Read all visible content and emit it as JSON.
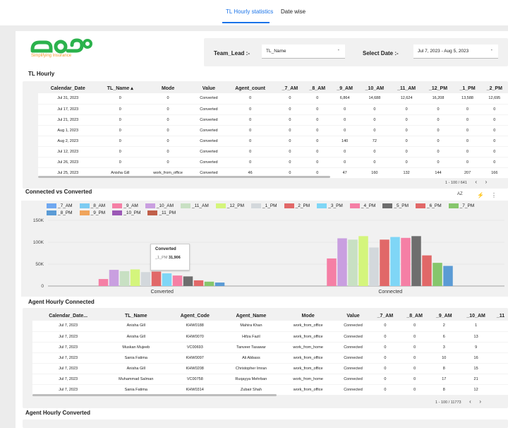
{
  "tabs": [
    {
      "label": "TL Hourly statistics"
    },
    {
      "label": "Date wise"
    }
  ],
  "brand": {
    "logo_text": "Simplifying Insurance",
    "green": "#2bb24c",
    "orange": "#f29a2e"
  },
  "filters": {
    "team_lead_label": "Team_Lead :-",
    "team_lead_value": "TL_Name",
    "date_label": "Select Date :-",
    "date_value": "Jul 7, 2023 - Aug 5, 2023"
  },
  "tl_hourly": {
    "title": "TL Hourly",
    "columns": [
      "Calendar_Date",
      "TL_Name ▴",
      "Mode",
      "Value",
      "Agent_count",
      "_7_AM",
      "_8_AM",
      "_9_AM",
      "_10_AM",
      "_11_AM",
      "_12_PM",
      "_1_PM",
      "_2_PM"
    ],
    "rows": [
      [
        "Jul 31, 2023",
        "0",
        "0",
        "Converted",
        "0",
        "0",
        "0",
        "6,864",
        "14,688",
        "12,624",
        "16,208",
        "13,588",
        "12,695"
      ],
      [
        "Jul 17, 2023",
        "0",
        "0",
        "Converted",
        "0",
        "0",
        "0",
        "0",
        "0",
        "0",
        "0",
        "0",
        "0"
      ],
      [
        "Jul 21, 2023",
        "0",
        "0",
        "Converted",
        "0",
        "0",
        "0",
        "0",
        "0",
        "0",
        "0",
        "0",
        "0"
      ],
      [
        "Aug 1, 2023",
        "0",
        "0",
        "Converted",
        "0",
        "0",
        "0",
        "0",
        "0",
        "0",
        "0",
        "0",
        "0"
      ],
      [
        "Aug 2, 2023",
        "0",
        "0",
        "Converted",
        "0",
        "0",
        "0",
        "140",
        "72",
        "0",
        "0",
        "0",
        "0"
      ],
      [
        "Jul 12, 2023",
        "0",
        "0",
        "Converted",
        "0",
        "0",
        "0",
        "0",
        "0",
        "0",
        "0",
        "0",
        "0"
      ],
      [
        "Jul 26, 2023",
        "0",
        "0",
        "Converted",
        "0",
        "0",
        "0",
        "0",
        "0",
        "0",
        "0",
        "0",
        "0"
      ],
      [
        "Jul 25, 2023",
        "Anisha Gill",
        "work_from_office",
        "Converted",
        "46",
        "0",
        "0",
        "47",
        "160",
        "132",
        "144",
        "207",
        "166"
      ]
    ],
    "pager": "1 - 100 / 641"
  },
  "connected_vs_converted": {
    "title": "Connected vs Converted",
    "tooltip": {
      "title": "Converted",
      "series": "_1_PM",
      "value": "31,906"
    }
  },
  "chart_data": {
    "type": "bar",
    "categories": [
      "Converted",
      "Connected"
    ],
    "yticks": [
      "150K",
      "100K",
      "50K",
      "0"
    ],
    "ylim": [
      0,
      150000
    ],
    "legend_position": "top",
    "series": [
      {
        "name": "_7_AM",
        "color": "#6fa8f0",
        "values": [
          0,
          0
        ]
      },
      {
        "name": "_8_AM",
        "color": "#7ccbf2",
        "values": [
          0,
          0
        ]
      },
      {
        "name": "_9_AM",
        "color": "#f57fa5",
        "values": [
          16000,
          63000
        ]
      },
      {
        "name": "_10_AM",
        "color": "#c99fe0",
        "values": [
          37000,
          109000
        ]
      },
      {
        "name": "_11_AM",
        "color": "#c8e0c3",
        "values": [
          34000,
          106000
        ]
      },
      {
        "name": "_12_PM",
        "color": "#d4f57c",
        "values": [
          38000,
          114000
        ]
      },
      {
        "name": "_1_PM",
        "color": "#d3d8dc",
        "values": [
          31906,
          88000
        ]
      },
      {
        "name": "_2_PM",
        "color": "#e16868",
        "values": [
          33000,
          106000
        ]
      },
      {
        "name": "_3_PM",
        "color": "#7fd6f6",
        "values": [
          29000,
          112000
        ]
      },
      {
        "name": "_4_PM",
        "color": "#f57fa5",
        "values": [
          24000,
          110000
        ]
      },
      {
        "name": "_5_PM",
        "color": "#6e6e6e",
        "values": [
          22000,
          114000
        ]
      },
      {
        "name": "_6_PM",
        "color": "#e16868",
        "values": [
          13000,
          70000
        ]
      },
      {
        "name": "_7_PM",
        "color": "#86c66c",
        "values": [
          10000,
          53000
        ]
      },
      {
        "name": "_8_PM",
        "color": "#5b9bd5",
        "values": [
          8000,
          46000
        ]
      },
      {
        "name": "_9_PM",
        "color": "#f0a45b",
        "values": [
          0,
          0
        ]
      },
      {
        "name": "_10_PM",
        "color": "#9b59b6",
        "values": [
          0,
          0
        ]
      },
      {
        "name": "_11_PM",
        "color": "#c0604a",
        "values": [
          0,
          0
        ]
      }
    ]
  },
  "agent_connected": {
    "title": "Agent Hourly Connected",
    "columns": [
      "Calendar_Date...",
      "TL_Name",
      "Agent_Code",
      "Agent_Name",
      "Mode",
      "Value",
      "_7_AM",
      "_8_AM",
      "_9_AM",
      "_10_AM",
      "_11"
    ],
    "rows": [
      [
        "Jul 7, 2023",
        "Anisha Gill",
        "KHW0188",
        "Mahira Khan",
        "work_from_office",
        "Connected",
        "0",
        "0",
        "2",
        "1",
        ""
      ],
      [
        "Jul 7, 2023",
        "Anisha Gill",
        "KHW0070",
        "Hifza Fazil",
        "work_from_office",
        "Connected",
        "0",
        "0",
        "6",
        "13",
        ""
      ],
      [
        "Jul 7, 2023",
        "Muskan Mujeeb",
        "VC00693",
        "Tanveer Tasawar",
        "work_from_home",
        "Connected",
        "0",
        "0",
        "3",
        "9",
        ""
      ],
      [
        "Jul 7, 2023",
        "Sania Fatima",
        "KHW0097",
        "Ali Abbass",
        "work_from_office",
        "Connected",
        "0",
        "0",
        "10",
        "16",
        ""
      ],
      [
        "Jul 7, 2023",
        "Anisha Gill",
        "KHW0208",
        "Christopher Imran",
        "work_from_office",
        "Connected",
        "0",
        "0",
        "8",
        "15",
        ""
      ],
      [
        "Jul 7, 2023",
        "Muhammad Salman",
        "VC00758",
        "Ruqayya Mehrban",
        "work_from_home",
        "Connected",
        "0",
        "0",
        "17",
        "21",
        ""
      ],
      [
        "Jul 7, 2023",
        "Sania Fatima",
        "KHW0314",
        "Zubair Shah",
        "work_from_office",
        "Connected",
        "0",
        "0",
        "8",
        "12",
        ""
      ]
    ],
    "pager": "1 - 100 / 11773"
  },
  "agent_converted": {
    "title": "Agent Hourly Converted"
  },
  "icons": {
    "prev": "‹",
    "next": "›",
    "sort": "AZ",
    "bolt": "⚡",
    "more": "⋮"
  }
}
